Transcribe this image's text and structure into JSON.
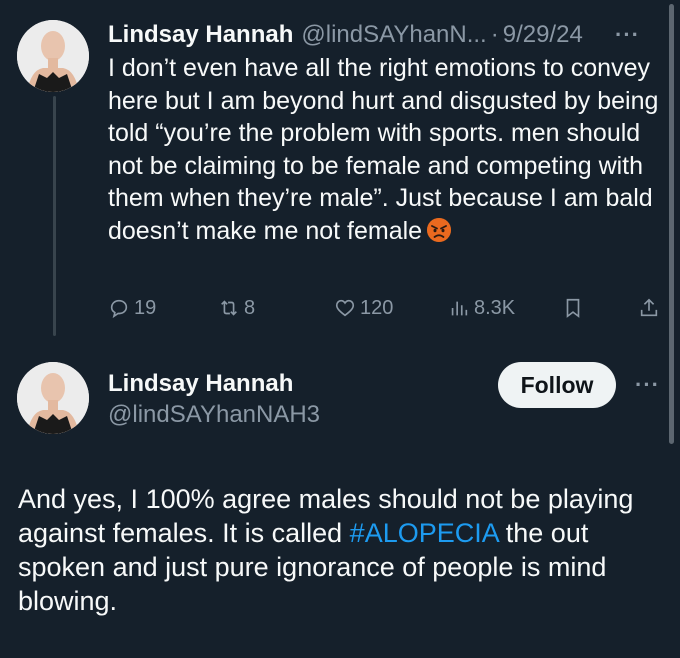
{
  "tweet1": {
    "author_name": "Lindsay Hannah",
    "author_handle": "@lindSAYhanN...",
    "separator": "·",
    "date": "9/29/24",
    "more": "···",
    "text": "I don’t even have all the right emotions to convey here but I am beyond hurt and disgusted by being told “you’re the problem with sports. men should not be claiming to be female and competing with them when they’re male”. Just because I am bald doesn’t make me not female",
    "emoji": "angry-face",
    "actions": {
      "replies": "19",
      "reposts": "8",
      "likes": "120",
      "views": "8.3K"
    }
  },
  "tweet2": {
    "author_name": "Lindsay Hannah",
    "author_handle": "@lindSAYhanNAH3",
    "follow_label": "Follow",
    "more": "···",
    "text_before": "And yes, I 100% agree males should not be playing against females. It is called ",
    "hashtag": "#ALOPECIA",
    "text_after": " the out spoken and just pure ignorance of people is mind blowing."
  },
  "colors": {
    "background": "#15202b",
    "text": "#f7f9f9",
    "muted": "#8b98a5",
    "link": "#1d9bf0"
  }
}
